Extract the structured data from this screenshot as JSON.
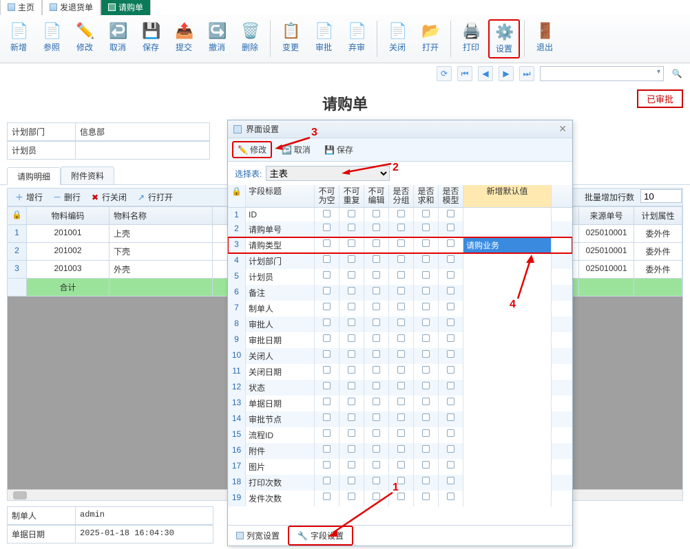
{
  "tabs": {
    "home": "主页",
    "return": "发退货单",
    "req": "请购单"
  },
  "toolbar": {
    "new": "新增",
    "ref": "参照",
    "edit": "修改",
    "cancel": "取消",
    "save": "保存",
    "submit": "提交",
    "revoke": "撤消",
    "delete": "删除",
    "change": "变更",
    "approve": "审批",
    "reject": "弃审",
    "close": "关闭",
    "open": "打开",
    "print": "打印",
    "settings": "设置",
    "exit": "退出"
  },
  "page_title": "请购单",
  "approved_label": "已审批",
  "form_head": {
    "dept_label": "计划部门",
    "dept_value": "信息部",
    "planner_label": "计划员",
    "planner_value": ""
  },
  "sub_tabs": {
    "detail": "请购明细",
    "attach": "附件资料"
  },
  "grid_toolbar": {
    "add_row": "增行",
    "del_row": "删行",
    "close_row": "行关闭",
    "open_row": "行打开",
    "batch_label": "批量增加行数",
    "batch_value": "10"
  },
  "data_cols": {
    "code": "物料编码",
    "name": "物料名称",
    "src": "来源单号",
    "plan": "计划属性"
  },
  "data_rows": [
    {
      "n": "1",
      "code": "201001",
      "name": "上壳",
      "src": "025010001",
      "plan": "委外件"
    },
    {
      "n": "2",
      "code": "201002",
      "name": "下壳",
      "src": "025010001",
      "plan": "委外件"
    },
    {
      "n": "3",
      "code": "201003",
      "name": "外壳",
      "src": "025010001",
      "plan": "委外件"
    }
  ],
  "total_label": "合计",
  "footer": {
    "maker_label": "制单人",
    "maker_value": "admin",
    "date_label": "单据日期",
    "date_value": "2025-01-18 16:04:30"
  },
  "dialog": {
    "title": "界面设置",
    "btn_edit": "修改",
    "btn_cancel": "取消",
    "btn_save": "保存",
    "select_label": "选择表:",
    "select_value": "主表",
    "cols": {
      "title": "字段标题",
      "nn": "不可\n为空",
      "nr": "不可\n重复",
      "ne": "不可\n编辑",
      "grp": "是否\n分组",
      "sum": "是否\n求和",
      "model": "是否\n模型",
      "def": "新增默认值"
    },
    "rows": [
      {
        "n": "1",
        "t": "ID"
      },
      {
        "n": "2",
        "t": "请购单号"
      },
      {
        "n": "3",
        "t": "请购类型",
        "def": "请购业务",
        "sel": true
      },
      {
        "n": "4",
        "t": "计划部门"
      },
      {
        "n": "5",
        "t": "计划员"
      },
      {
        "n": "6",
        "t": "备注"
      },
      {
        "n": "7",
        "t": "制单人"
      },
      {
        "n": "8",
        "t": "审批人"
      },
      {
        "n": "9",
        "t": "审批日期"
      },
      {
        "n": "10",
        "t": "关闭人"
      },
      {
        "n": "11",
        "t": "关闭日期"
      },
      {
        "n": "12",
        "t": "状态"
      },
      {
        "n": "13",
        "t": "单据日期"
      },
      {
        "n": "14",
        "t": "审批节点"
      },
      {
        "n": "15",
        "t": "流程ID"
      },
      {
        "n": "16",
        "t": "附件"
      },
      {
        "n": "17",
        "t": "图片"
      },
      {
        "n": "18",
        "t": "打印次数"
      },
      {
        "n": "19",
        "t": "发件次数"
      }
    ],
    "bottom_tabs": {
      "col_width": "列宽设置",
      "field": "字段设置"
    }
  },
  "anno": {
    "a1": "1",
    "a2": "2",
    "a3": "3",
    "a4": "4"
  }
}
